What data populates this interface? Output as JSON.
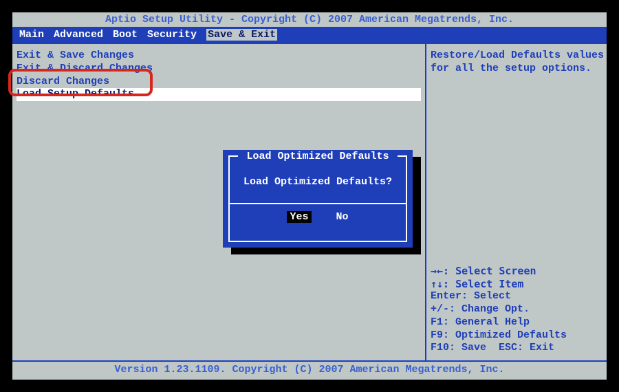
{
  "header": {
    "title": "Aptio Setup Utility - Copyright (C) 2007 American Megatrends, Inc."
  },
  "menu": {
    "items": [
      "Main",
      "Advanced",
      "Boot",
      "Security",
      "Save & Exit"
    ],
    "selected_index": 4
  },
  "left": {
    "items": [
      "Exit & Save Changes",
      "Exit & Discard Changes",
      "Discard Changes",
      "Load Setup Defaults"
    ],
    "highlight_index": 3
  },
  "right": {
    "help_lines": [
      "Restore/Load Defaults values",
      "for all the setup options."
    ],
    "keys": [
      "→←: Select Screen",
      "↑↓: Select Item",
      "Enter: Select",
      "+/-: Change Opt.",
      "F1: General Help",
      "F9: Optimized Defaults",
      "F10: Save  ESC: Exit"
    ]
  },
  "dialog": {
    "title": "Load Optimized Defaults",
    "message": "Load Optimized Defaults?",
    "yes": "Yes",
    "no": "No",
    "selected": "yes"
  },
  "footer": {
    "text": "Version 1.23.1109. Copyright (C) 2007 American Megatrends, Inc."
  }
}
